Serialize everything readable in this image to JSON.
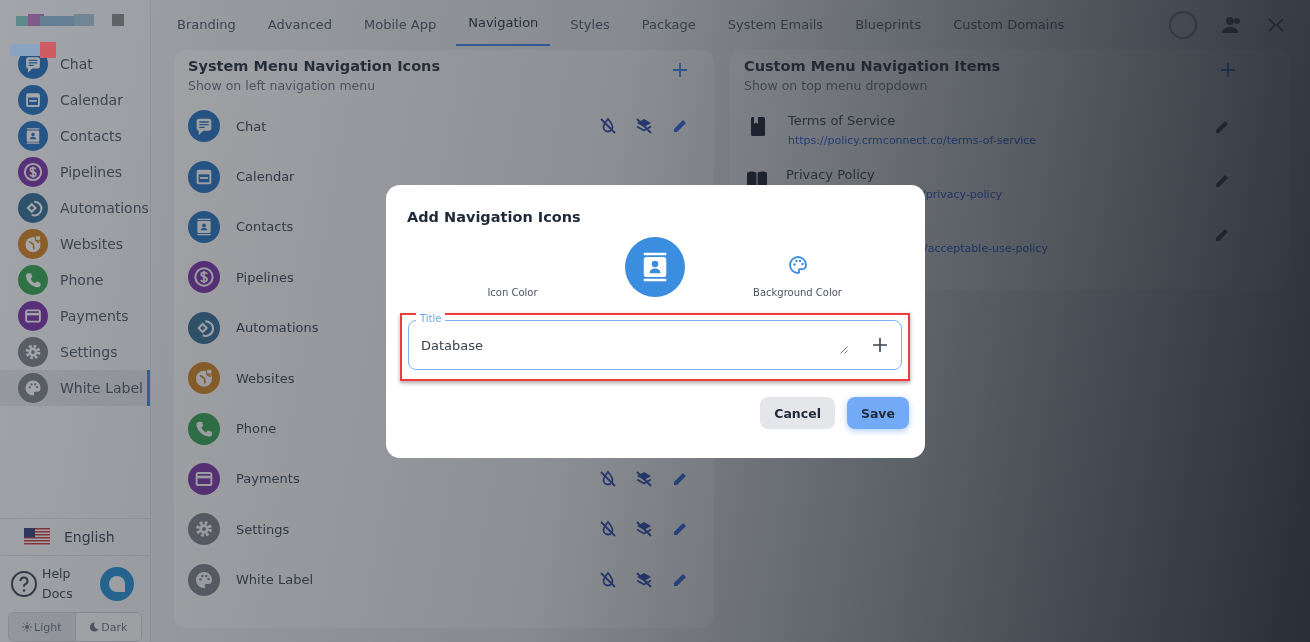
{
  "sidebar": {
    "items": [
      {
        "label": "Chat",
        "selected": false
      },
      {
        "label": "Calendar",
        "selected": false
      },
      {
        "label": "Contacts",
        "selected": false
      },
      {
        "label": "Pipelines",
        "selected": false
      },
      {
        "label": "Automations",
        "selected": false
      },
      {
        "label": "Websites",
        "selected": false
      },
      {
        "label": "Phone",
        "selected": false
      },
      {
        "label": "Payments",
        "selected": false
      },
      {
        "label": "Settings",
        "selected": false
      },
      {
        "label": "White Label",
        "selected": true
      }
    ],
    "language": "English",
    "help": "Help Docs",
    "theme": [
      {
        "label": "Light",
        "selected": true
      },
      {
        "label": "Dark",
        "selected": false
      }
    ]
  },
  "tabs": [
    {
      "label": "Branding",
      "selected": false
    },
    {
      "label": "Advanced",
      "selected": false
    },
    {
      "label": "Mobile App",
      "selected": false
    },
    {
      "label": "Navigation",
      "selected": true
    },
    {
      "label": "Styles",
      "selected": false
    },
    {
      "label": "Package",
      "selected": false
    },
    {
      "label": "System Emails",
      "selected": false
    },
    {
      "label": "Blueprints",
      "selected": false
    },
    {
      "label": "Custom Domains",
      "selected": false
    }
  ],
  "system_menu": {
    "title": "System Menu Navigation Icons",
    "subtitle": "Show on left navigation menu",
    "items": [
      {
        "label": "Chat"
      },
      {
        "label": "Calendar"
      },
      {
        "label": "Contacts"
      },
      {
        "label": "Pipelines"
      },
      {
        "label": "Automations"
      },
      {
        "label": "Websites"
      },
      {
        "label": "Phone"
      },
      {
        "label": "Payments"
      },
      {
        "label": "Settings"
      },
      {
        "label": "White Label"
      }
    ]
  },
  "custom_menu": {
    "title": "Custom Menu Navigation Items",
    "subtitle": "Show on top menu dropdown",
    "items": [
      {
        "kind": "full",
        "title": "Terms of Service",
        "url": "https://policy.crmconnect.co/terms-of-service"
      },
      {
        "kind": "partial",
        "title": "Privacy Policy",
        "url": "/privacy-policy"
      },
      {
        "kind": "url_only",
        "url": "/acceptable-use-policy"
      }
    ]
  },
  "dialog": {
    "title": "Add Navigation Icons",
    "icon_color_label": "Icon Color",
    "background_color_label": "Background Color",
    "field": {
      "label": "Title",
      "value": "Database",
      "highlighted": true
    },
    "buttons": [
      {
        "label": "Cancel",
        "kind": "secondary"
      },
      {
        "label": "Save",
        "kind": "primary"
      }
    ]
  }
}
